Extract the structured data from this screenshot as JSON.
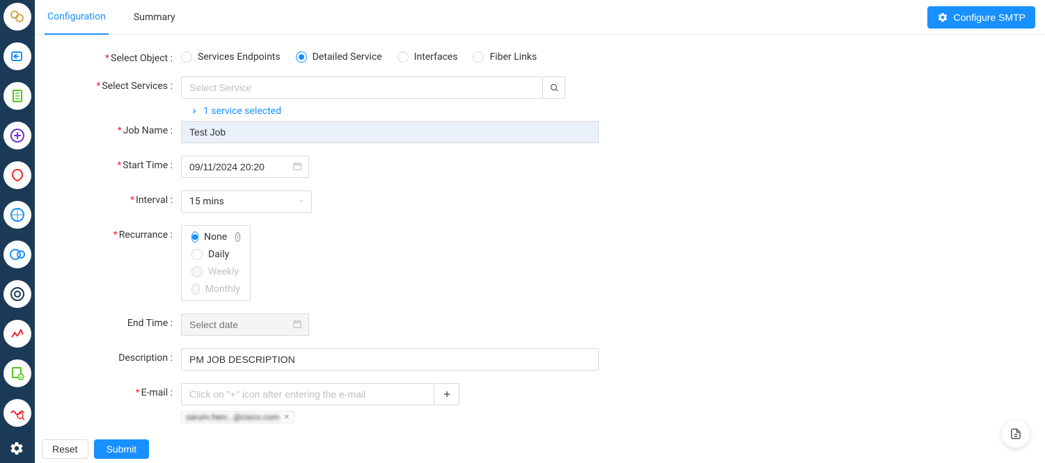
{
  "sidebar": {
    "items": [
      {
        "bg": "#ffffff",
        "stroke": "#d9a441"
      },
      {
        "bg": "#ffffff",
        "stroke": "#1890ff"
      },
      {
        "bg": "#ffffff",
        "stroke": "#52c41a"
      },
      {
        "bg": "#ffffff",
        "stroke": "#722ed1"
      },
      {
        "bg": "#ffffff",
        "stroke": "#f5222d"
      },
      {
        "bg": "#ffffff",
        "stroke": "#1890ff"
      },
      {
        "bg": "#ffffff",
        "stroke": "#1890ff"
      },
      {
        "bg": "#ffffff",
        "stroke": "#1b3a57"
      },
      {
        "bg": "#ffffff",
        "stroke": "#f5222d"
      },
      {
        "bg": "#ffffff",
        "stroke": "#52c41a"
      },
      {
        "bg": "#ffffff",
        "stroke": "#f5222d"
      }
    ]
  },
  "header": {
    "tabs": {
      "configuration": "Configuration",
      "summary": "Summary"
    },
    "configure_smtp": "Configure SMTP"
  },
  "form": {
    "select_object": {
      "label": "Select Object",
      "options": {
        "services_endpoints": "Services Endpoints",
        "detailed_service": "Detailed Service",
        "interfaces": "Interfaces",
        "fiber_links": "Fiber Links"
      }
    },
    "select_services": {
      "label": "Select Services",
      "placeholder": "Select Service",
      "expand_text": "1 service selected"
    },
    "job_name": {
      "label": "Job Name",
      "value": "Test Job"
    },
    "start_time": {
      "label": "Start Time",
      "value": "09/11/2024 20:20"
    },
    "interval": {
      "label": "Interval",
      "value": "15 mins"
    },
    "recurrance": {
      "label": "Recurrance",
      "options": {
        "none": "None",
        "daily": "Daily",
        "weekly": "Weekly",
        "monthly": "Monthly"
      }
    },
    "end_time": {
      "label": "End Time",
      "placeholder": "Select date"
    },
    "description": {
      "label": "Description",
      "value": "PM JOB DESCRIPTION"
    },
    "email": {
      "label": "E-mail",
      "placeholder": "Click on \"+\" icon after entering the e-mail",
      "tag": "sarum.herc…@cisco.com"
    }
  },
  "footer": {
    "reset": "Reset",
    "submit": "Submit"
  }
}
